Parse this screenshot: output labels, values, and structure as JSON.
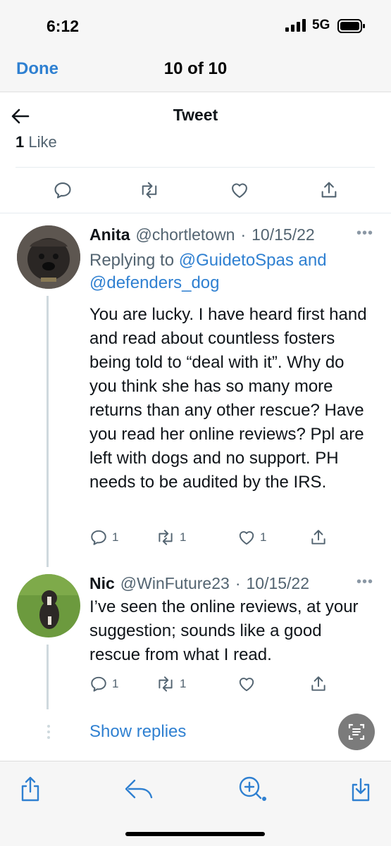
{
  "status": {
    "time": "6:12",
    "network": "5G"
  },
  "viewer": {
    "done_label": "Done",
    "counter": "10 of 10"
  },
  "tweet_view": {
    "title": "Tweet",
    "likes_count": "1",
    "likes_label": "Like"
  },
  "replies": [
    {
      "name": "Anita",
      "handle": "@chortletown",
      "date": "10/15/22",
      "replying_prefix": "Replying to",
      "replying_links": "@GuidetoSpas and @defenders_dog",
      "body": "You are lucky. I have heard first hand and read about countless fosters being told to “deal with it”. Why do you think she has so many more returns than any other rescue? Have you read her online reviews? Ppl are left with dogs and no support. PH needs to be audited by the IRS.",
      "reply_count": "1",
      "retweet_count": "1",
      "like_count": "1"
    },
    {
      "name": "Nic",
      "handle": "@WinFuture23",
      "date": "10/15/22",
      "body": "I’ve seen the online reviews, at your suggestion; sounds like a good rescue from what I read.",
      "reply_count": "1",
      "retweet_count": "1",
      "like_count": ""
    }
  ],
  "show_replies_label": "Show replies",
  "colors": {
    "link": "#2f80d1",
    "muted": "#536471",
    "thread_line": "#cfd9de"
  },
  "icons": [
    "back-arrow-icon",
    "reply-icon",
    "retweet-icon",
    "like-icon",
    "share-icon",
    "more-icon",
    "text-scan-icon",
    "toolbar-share-icon",
    "toolbar-reply-icon",
    "toolbar-zoom-icon",
    "toolbar-download-icon"
  ]
}
